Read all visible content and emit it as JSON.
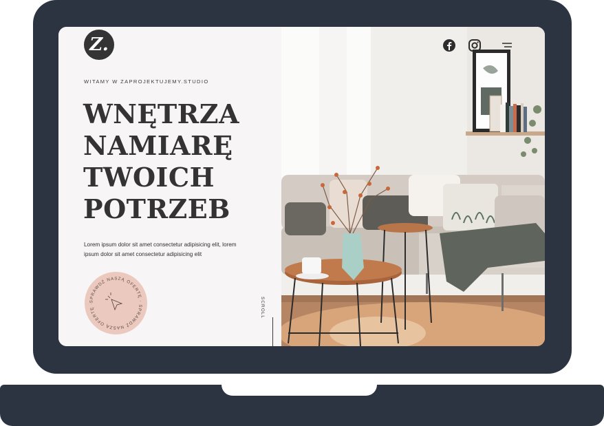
{
  "site": {
    "logo_letter": "Z.",
    "welcome": "WITAMY W ZAPROJEKTUJEMY.STUDIO",
    "headline_lines": [
      "WNĘTRZA",
      "NAMIARĘ",
      "TWOICH",
      "POTRZEB"
    ],
    "lorem_line1": "Lorem ipsum dolor sit amet consectetur adipisicing elit, lorem",
    "lorem_line2": "ipsum dolor sit amet consectetur adipisicing elit",
    "badge_text": "SPRAWDŹ NASZĄ OFERTĘ · SPRAWDŹ NASZĄ OFERTĘ · ",
    "scroll_label": "SCROLL"
  },
  "nav": {
    "icons": [
      "facebook-icon",
      "instagram-icon",
      "menu-icon"
    ]
  },
  "colors": {
    "laptop": "#2d3441",
    "text_dark": "#333333",
    "badge": "#ecc9bf",
    "background": "#f7f5f5"
  }
}
